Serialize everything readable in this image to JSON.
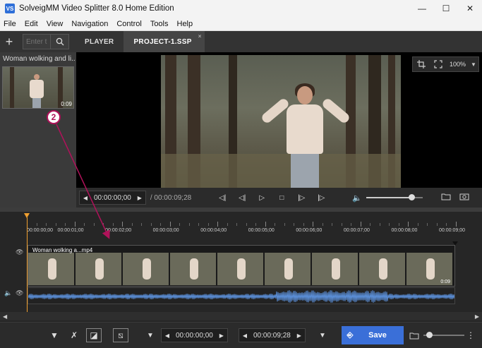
{
  "window": {
    "title": "SolveigMM Video Splitter 8.0 Home Edition",
    "app_icon": "VS",
    "minimize": "—",
    "maximize": "☐",
    "close": "✕"
  },
  "menu": [
    "File",
    "Edit",
    "View",
    "Navigation",
    "Control",
    "Tools",
    "Help"
  ],
  "toolbar": {
    "add": "+",
    "search_placeholder": "Enter t",
    "tabs": [
      {
        "label": "PLAYER"
      },
      {
        "label": "PROJECT-1.SSP",
        "close": "×"
      }
    ]
  },
  "media": {
    "name": "Woman wolking and li...",
    "duration": "0:09"
  },
  "video_tools": {
    "zoom": "100%"
  },
  "playback": {
    "current": "00:00:00;00",
    "total": "/ 00:00:09;28",
    "volume": 0.8
  },
  "timeline": {
    "ticks": [
      "00:00:00;00",
      "00:00:01;00",
      "00:00:02;00",
      "00:00:03;00",
      "00:00:04;00",
      "00:00:05;00",
      "00:00:06;00",
      "00:00:07;00",
      "00:00:08;00",
      "00:00:09;00"
    ],
    "clip_name": "Woman wolking a...mp4",
    "clip_duration": "0:09"
  },
  "bottom": {
    "start": "00:00:00;00",
    "end": "00:00:09;28",
    "save": "Save"
  },
  "callout": {
    "number": "2",
    "color": "#b0125a"
  },
  "colors": {
    "accent": "#3a6fd8",
    "playhead": "#f0a030",
    "waveform": "#5b8fd8"
  }
}
